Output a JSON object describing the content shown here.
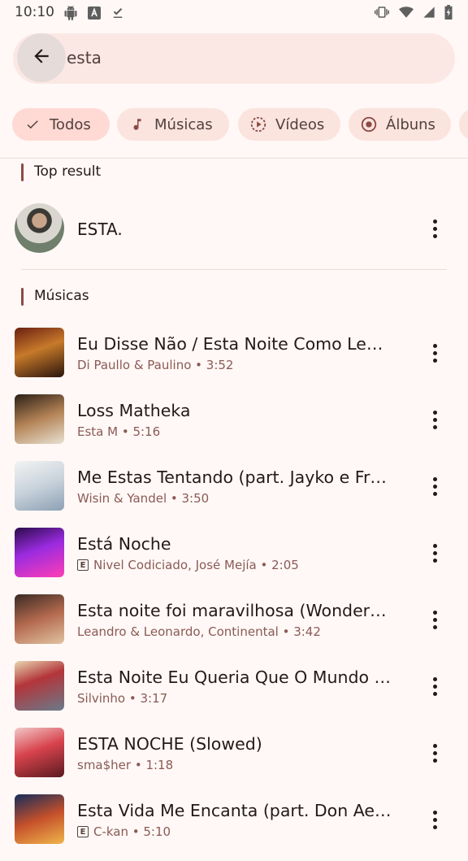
{
  "status_bar": {
    "time": "10:10"
  },
  "search": {
    "query": "esta"
  },
  "chips": [
    {
      "label": "Todos",
      "icon": "check-icon",
      "selected": true
    },
    {
      "label": "Músicas",
      "icon": "music-note-icon",
      "selected": false
    },
    {
      "label": "Vídeos",
      "icon": "video-play-icon",
      "selected": false
    },
    {
      "label": "Álbuns",
      "icon": "album-icon",
      "selected": false
    }
  ],
  "top_result": {
    "section_title": "Top result",
    "title": "ESTA."
  },
  "songs_section": {
    "title": "Músicas",
    "items": [
      {
        "title": "Eu Disse Não / Esta Noite Como Le…",
        "subtitle": "Di Paullo & Paulino • 3:52",
        "explicit": false
      },
      {
        "title": "Loss Matheka",
        "subtitle": "Esta M • 5:16",
        "explicit": false
      },
      {
        "title": "Me Estas Tentando (part. Jayko e Fr…",
        "subtitle": "Wisin & Yandel • 3:50",
        "explicit": false
      },
      {
        "title": "Está Noche",
        "subtitle": "Nivel Codiciado, José Mejía • 2:05",
        "explicit": true
      },
      {
        "title": "Esta noite foi maravilhosa (Wonder…",
        "subtitle": "Leandro & Leonardo, Continental • 3:42",
        "explicit": false
      },
      {
        "title": "Esta Noite Eu Queria Que O Mundo …",
        "subtitle": "Silvinho • 3:17",
        "explicit": false
      },
      {
        "title": "ESTA NOCHE (Slowed)",
        "subtitle": "sma$her • 1:18",
        "explicit": false
      },
      {
        "title": "Esta Vida Me Encanta (part. Don Ae…",
        "subtitle": "C-kan • 5:10",
        "explicit": true
      }
    ]
  }
}
